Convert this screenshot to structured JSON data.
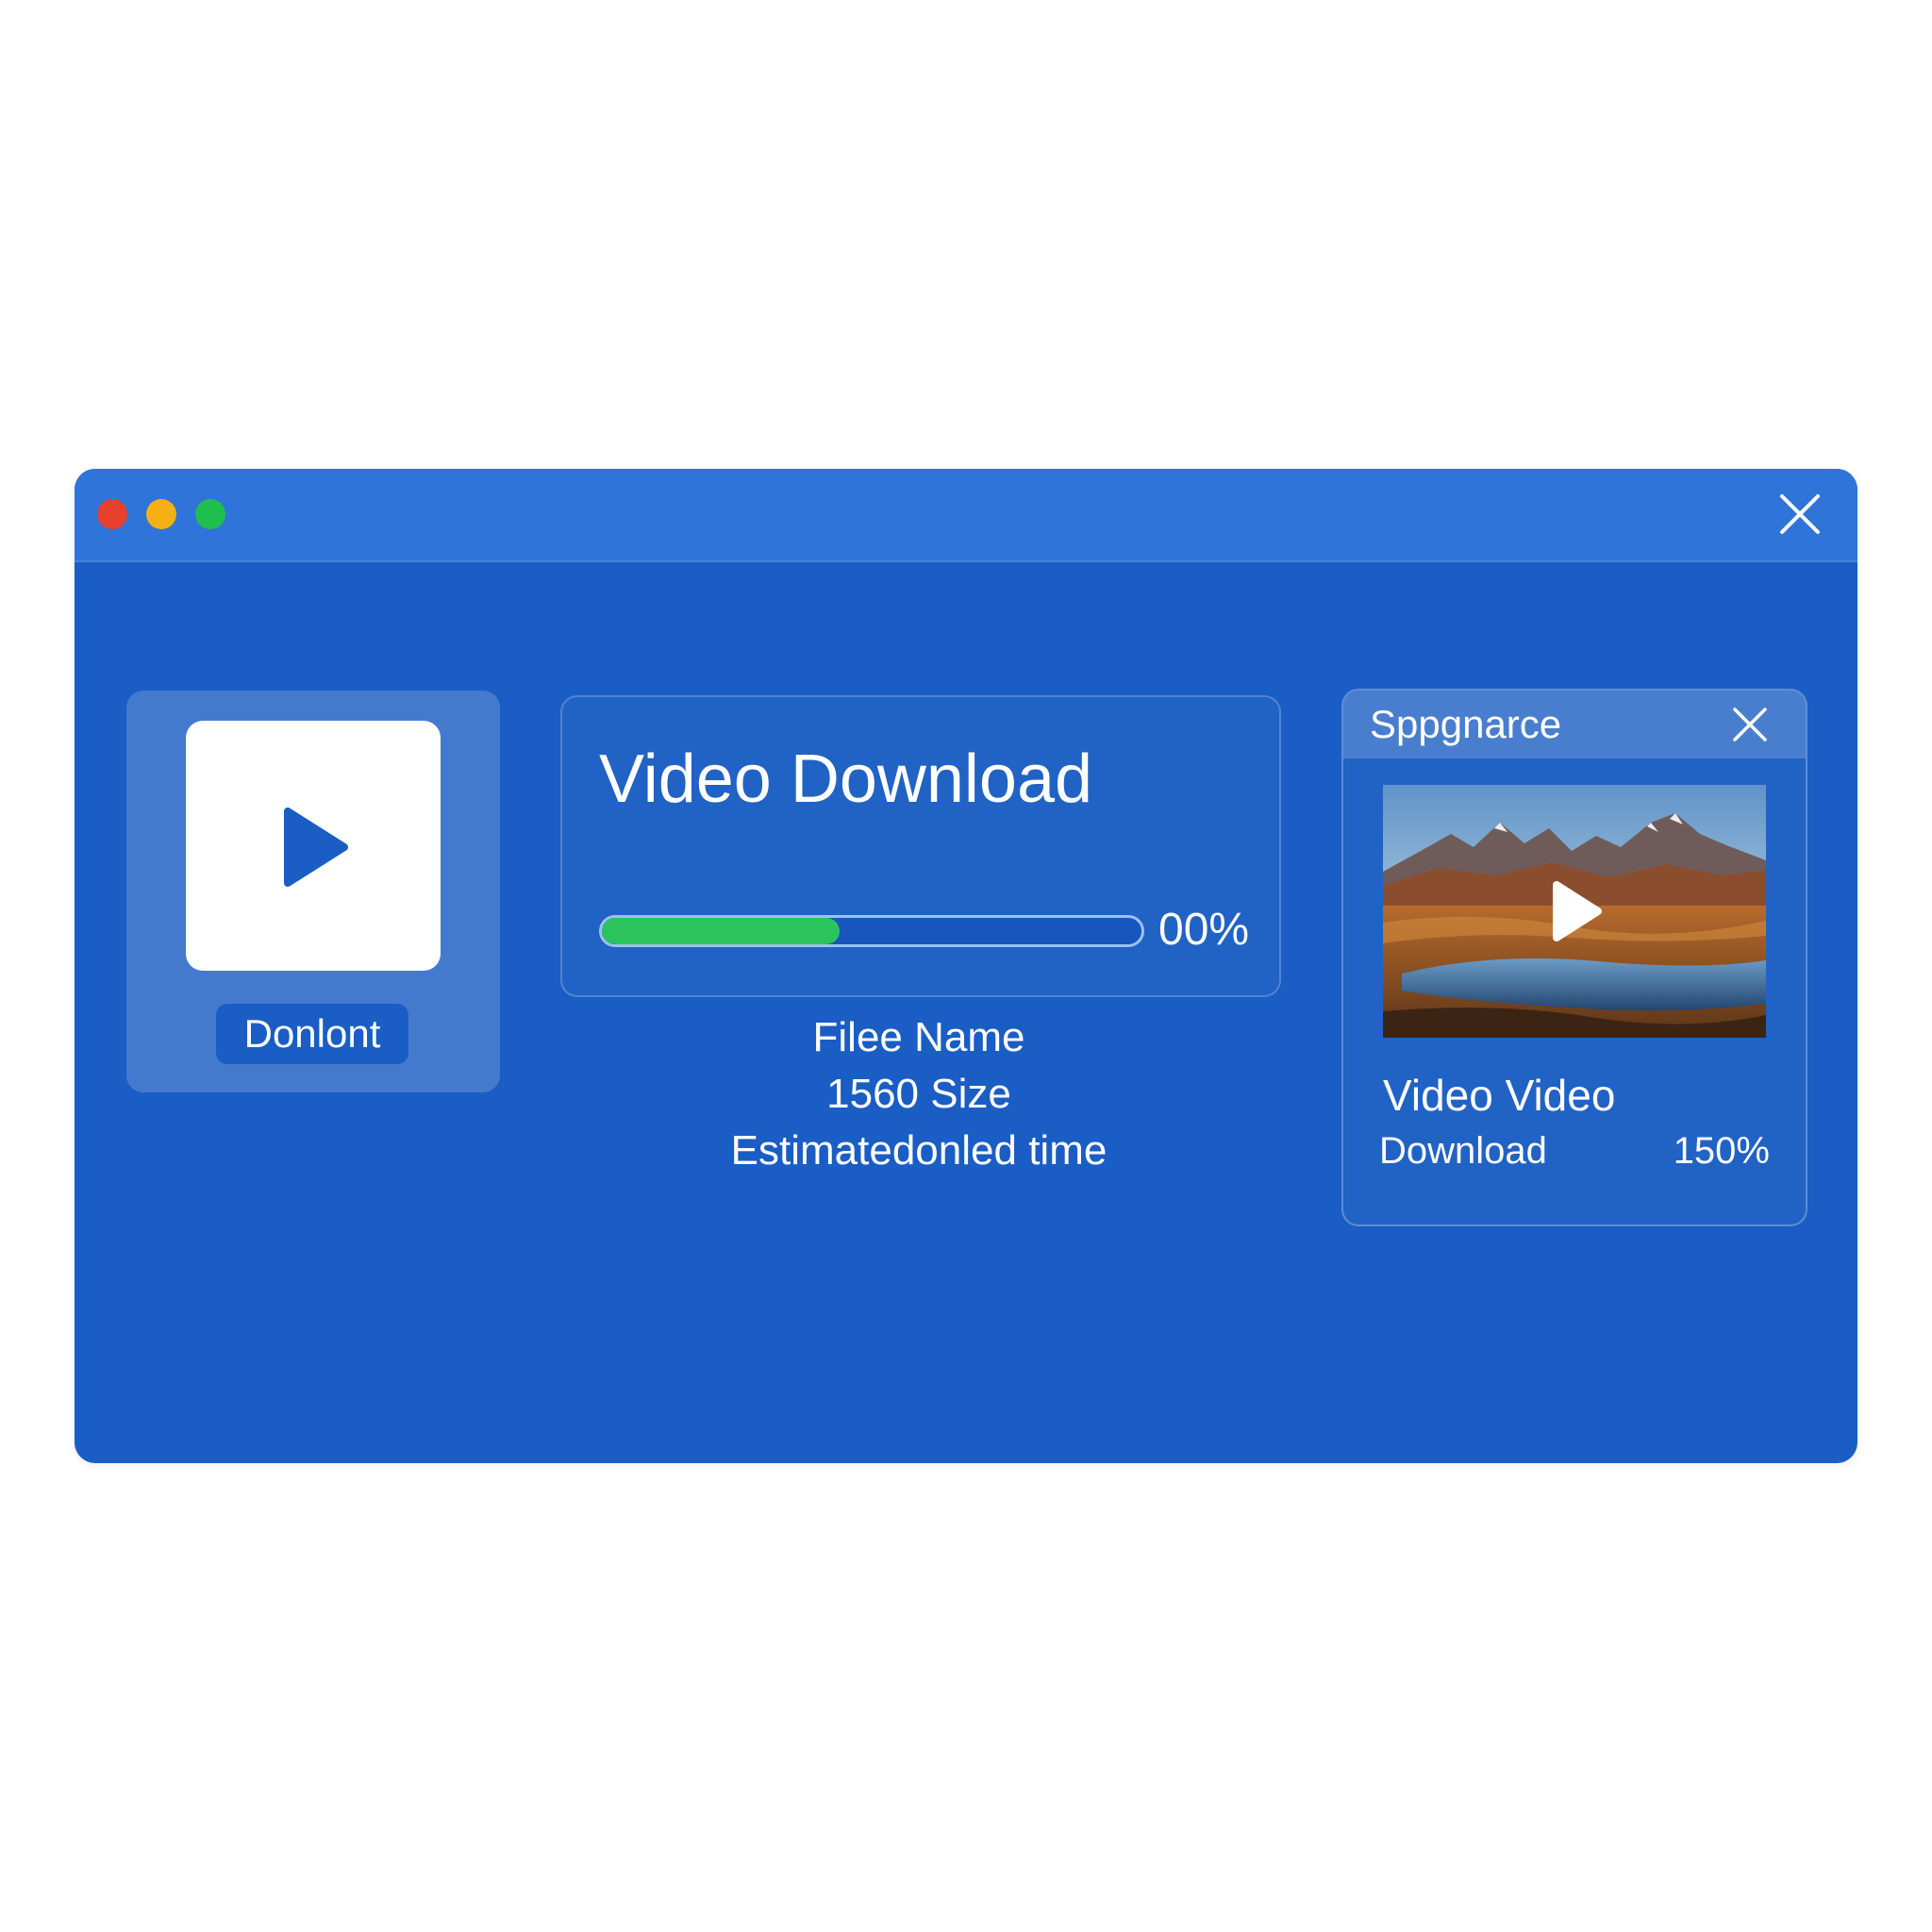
{
  "window": {
    "controls": [
      "close-dot",
      "minimize-dot",
      "zoom-dot"
    ],
    "close_icon": "close-icon"
  },
  "left_card": {
    "icon": "play-icon",
    "button_label": "Donlont"
  },
  "download": {
    "title": "Video Download",
    "progress_label": "00%",
    "progress_fraction": 0.44,
    "file_name": "Filee Name",
    "size": "1560 Size",
    "estimate": "Estimatedonled time"
  },
  "right_panel": {
    "header_title": "Sppgnarce",
    "close_icon": "close-icon",
    "thumbnail_icon": "play-icon",
    "title": "Video Video",
    "subtitle": "Download",
    "percent": "150%"
  },
  "colors": {
    "window_bg": "#1a5dc4",
    "titlebar_bg": "#2f74d8",
    "progress_fill": "#2bc45c",
    "dot_red": "#e8402f",
    "dot_yellow": "#f5b014",
    "dot_green": "#1fbf4e"
  }
}
